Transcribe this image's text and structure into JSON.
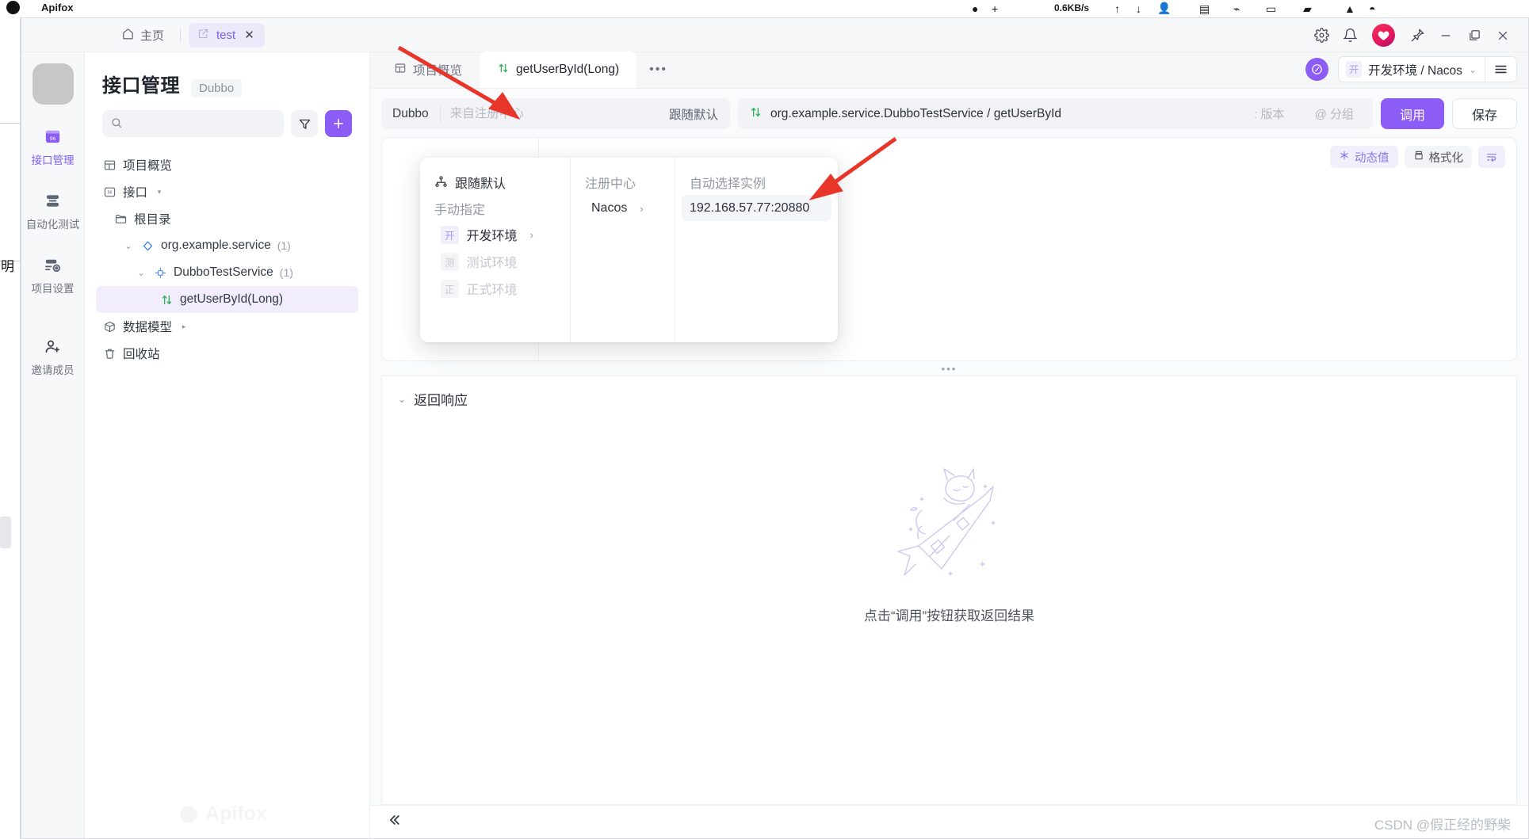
{
  "os": {
    "app_name": "Apifox",
    "net_speed": "0.6KB/s",
    "side_char": "明"
  },
  "titlebar": {
    "home_label": "主页",
    "home_icon": "home-icon",
    "tab_label": "test",
    "tab_icon": "doc-link-icon",
    "tab_close": "✕",
    "actions": [
      {
        "name": "settings-icon",
        "glyph": "gear-icon"
      },
      {
        "name": "notifications-icon",
        "glyph": "bell-icon"
      },
      {
        "name": "pin-icon",
        "glyph": "pin-icon"
      },
      {
        "name": "minimize-icon",
        "glyph": "−"
      },
      {
        "name": "maximize-icon",
        "glyph": "maximize-icon"
      },
      {
        "name": "close-icon",
        "glyph": "✕"
      }
    ]
  },
  "rail": {
    "items": [
      {
        "label": "接口管理",
        "icon": "api-management-icon",
        "active": true
      },
      {
        "label": "自动化测试",
        "icon": "automation-test-icon",
        "active": false
      },
      {
        "label": "项目设置",
        "icon": "project-settings-icon",
        "active": false
      },
      {
        "label": "邀请成员",
        "icon": "invite-member-icon",
        "active": false
      }
    ]
  },
  "explorer": {
    "title": "接口管理",
    "badge": "Dubbo",
    "search_placeholder": "",
    "search_value": "",
    "filter_icon": "filter-icon",
    "add_icon": "plus-icon",
    "watermark": "Apifox",
    "tree": [
      {
        "label": "项目概览",
        "icon": "overview-icon",
        "indent": 0,
        "caret": "",
        "count": "",
        "selected": false
      },
      {
        "label": "接口",
        "icon": "api-icon",
        "indent": 0,
        "caret": "▾",
        "count": "",
        "selected": false
      },
      {
        "label": "根目录",
        "icon": "folder-icon",
        "indent": 1,
        "caret": "",
        "count": "",
        "selected": false
      },
      {
        "label": "org.example.service",
        "icon": "service-diamond-icon",
        "indent": 2,
        "caret": "⌄",
        "count": "(1)",
        "selected": false
      },
      {
        "label": "DubboTestService",
        "icon": "interface-node-icon",
        "indent": 3,
        "caret": "⌄",
        "count": "(1)",
        "selected": false
      },
      {
        "label": "getUserById(Long)",
        "icon": "method-arrows-icon",
        "indent": 4,
        "caret": "",
        "count": "",
        "selected": true
      },
      {
        "label": "数据模型",
        "icon": "data-model-icon",
        "indent": 0,
        "caret": "▸",
        "count": "",
        "selected": false
      },
      {
        "label": "回收站",
        "icon": "trash-icon",
        "indent": 0,
        "caret": "",
        "count": "",
        "selected": false
      }
    ]
  },
  "main": {
    "tabs": [
      {
        "label": "项目概览",
        "icon": "overview-icon",
        "active": false
      },
      {
        "label": "getUserById(Long)",
        "icon": "method-arrows-icon",
        "active": true
      }
    ],
    "more_label": "•••",
    "env": {
      "clock_icon": "clock-icon",
      "tag": "开",
      "name": "开发环境 / Nacos",
      "caret": "⌄",
      "menu_icon": "hamburger-icon"
    },
    "request": {
      "protocol": "Dubbo",
      "registry_placeholder": "来自注册中心",
      "registry_value": "",
      "follow_default": "跟随默认",
      "method_icon": "method-arrows-icon",
      "path": "org.example.service.DubboTestService / getUserById",
      "version_placeholder": ": 版本",
      "group_placeholder": "@ 分组",
      "run_label": "调用",
      "save_label": "保存",
      "tools": [
        {
          "label": "动态值",
          "icon": "dynamic-value-icon",
          "style": "purple"
        },
        {
          "label": "格式化",
          "icon": "format-icon",
          "style": "grey"
        },
        {
          "label": "",
          "icon": "wrap-lines-icon",
          "style": "sq"
        }
      ]
    },
    "response": {
      "caret": "⌄",
      "title": "返回响应",
      "empty_text": "点击“调用”按钮获取返回结果",
      "empty_illustration": "rocket-fox-icon"
    },
    "splitter_dots": "•••",
    "collapse_icon": "collapse-left-icon",
    "watermark": "CSDN @假正经的野柴"
  },
  "dropdown": {
    "column1": {
      "follow_default": {
        "label": "跟随默认",
        "icon": "share-nodes-icon"
      },
      "manual_label": "手动指定",
      "envs": [
        {
          "tag": "开",
          "label": "开发环境",
          "arrow": "›",
          "enabled": true
        },
        {
          "tag": "测",
          "label": "测试环境",
          "arrow": "",
          "enabled": false
        },
        {
          "tag": "正",
          "label": "正式环境",
          "arrow": "",
          "enabled": false
        }
      ]
    },
    "column2": {
      "header": "注册中心",
      "items": [
        {
          "label": "Nacos",
          "arrow": "›"
        }
      ]
    },
    "column3": {
      "header": "自动选择实例",
      "items": [
        {
          "label": "192.168.57.77:20880",
          "highlighted": true
        }
      ]
    }
  },
  "colors": {
    "accent": "#8b5cf6",
    "accent_soft": "#f1edfd",
    "method_green": "#2fb360",
    "annotation_red": "#e8352a",
    "text": "#2b313a",
    "muted": "#9298a2"
  }
}
